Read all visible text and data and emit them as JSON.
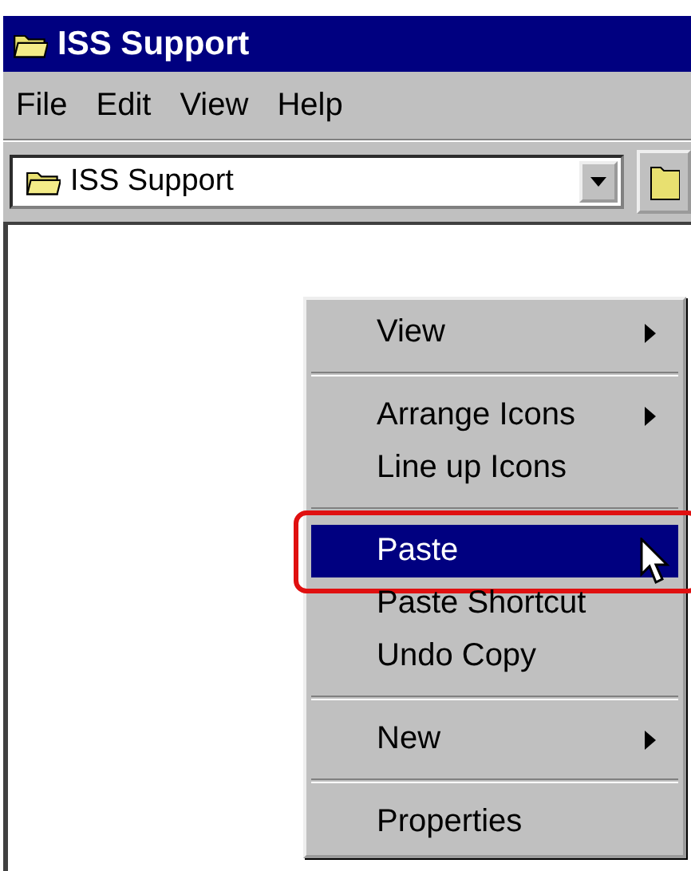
{
  "window": {
    "title": "ISS Support"
  },
  "menu_bar": [
    "File",
    "Edit",
    "View",
    "Help"
  ],
  "address": {
    "value": "ISS Support"
  },
  "context_menu": [
    {
      "kind": "item",
      "label": "View",
      "submenu": true,
      "selected": false,
      "highlighted": false
    },
    {
      "kind": "separator"
    },
    {
      "kind": "item",
      "label": "Arrange Icons",
      "submenu": true,
      "selected": false,
      "highlighted": false
    },
    {
      "kind": "item",
      "label": "Line up Icons",
      "submenu": false,
      "selected": false,
      "highlighted": false
    },
    {
      "kind": "separator"
    },
    {
      "kind": "item",
      "label": "Paste",
      "submenu": false,
      "selected": true,
      "highlighted": true
    },
    {
      "kind": "item",
      "label": "Paste Shortcut",
      "submenu": false,
      "selected": false,
      "highlighted": false
    },
    {
      "kind": "item",
      "label": "Undo Copy",
      "submenu": false,
      "selected": false,
      "highlighted": false
    },
    {
      "kind": "separator"
    },
    {
      "kind": "item",
      "label": "New",
      "submenu": true,
      "selected": false,
      "highlighted": false
    },
    {
      "kind": "separator"
    },
    {
      "kind": "item",
      "label": "Properties",
      "submenu": false,
      "selected": false,
      "highlighted": false
    }
  ]
}
